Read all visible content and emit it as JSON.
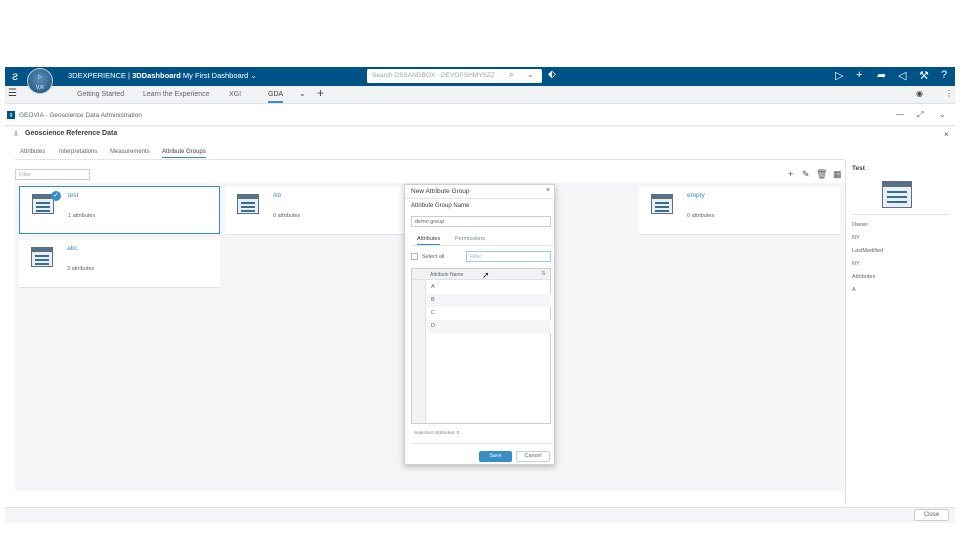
{
  "topbar": {
    "brand_prefix": "3DEXPERIENCE | ",
    "brand_app": "3DDashboard",
    "brand_dashboard": "My First Dashboard",
    "compass_label": "V,R",
    "search_placeholder": "Search DSSANDBOX - DEVOPSHMYSZZ"
  },
  "tabs": [
    {
      "label": "Getting Started"
    },
    {
      "label": "Learn the Experience"
    },
    {
      "label": "XGI"
    },
    {
      "label": "GDA"
    }
  ],
  "app_header": {
    "title": "GEOVIA - Geoscience Data Administration"
  },
  "panel": {
    "title": "Geoscience Reference Data",
    "tabs": [
      "Attributes",
      "Interpretations",
      "Measurements",
      "Attribute Groups"
    ],
    "filter_placeholder": "Filter"
  },
  "cards": [
    {
      "title": "test",
      "count": "1 attributes"
    },
    {
      "title": "Ab",
      "count": "0 attributes"
    },
    {
      "title": "empty",
      "count": "0 attributes"
    },
    {
      "title": "abc",
      "count": "3 attributes"
    }
  ],
  "info": {
    "title": "Test",
    "owner_label": "Owner",
    "owner_value": "NY",
    "modified_label": "LastModified",
    "modified_value": "NY",
    "attributes_label": "Attributes",
    "attributes_value": "A"
  },
  "footer": {
    "close_label": "Close"
  },
  "dialog": {
    "title": "New Attribute Group",
    "name_label": "Attribute Group Name",
    "name_value": "demo group",
    "tabs": [
      "Attributes",
      "Permissions"
    ],
    "select_all_label": "Select all",
    "filter_placeholder": "Filter",
    "column_header": "Attribute Name",
    "rows": [
      "A",
      "B",
      "C",
      "D"
    ],
    "selected_text": "Selected Attributes: 0",
    "save_label": "Save",
    "cancel_label": "Cancel"
  },
  "colors": {
    "topbar": "#005386",
    "accent": "#368ec4"
  }
}
